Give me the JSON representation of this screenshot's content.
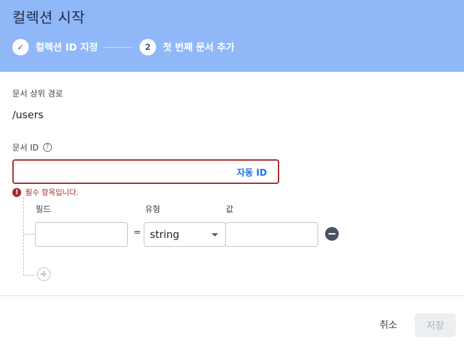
{
  "dialog": {
    "title": "컬렉션 시작",
    "steps": [
      {
        "marker": "✓",
        "label": "컬렉션 ID 지정"
      },
      {
        "marker": "2",
        "label": "첫 번째 문서 추가"
      }
    ]
  },
  "form": {
    "parent_path_label": "문서 상위 경로",
    "parent_path_value": "/users",
    "doc_id_label": "문서 ID",
    "help_icon": "?",
    "doc_id_value": "",
    "auto_id_label": "자동 ID",
    "error_icon": "!",
    "error_text": "필수 항목입니다.",
    "columns": {
      "field": "필드",
      "type": "유형",
      "value": "값"
    },
    "row": {
      "field_value": "",
      "equals": "=",
      "type_value": "string",
      "value_value": ""
    }
  },
  "footer": {
    "cancel_label": "취소",
    "save_label": "저장"
  },
  "colors": {
    "header": "#90b8f8",
    "error": "#a52a2a",
    "accent": "#1a73e8"
  }
}
